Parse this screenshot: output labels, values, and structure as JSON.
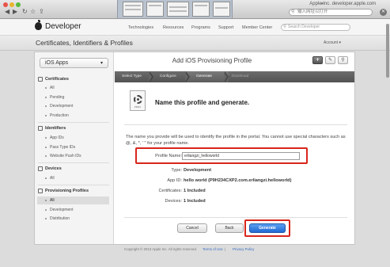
{
  "browser": {
    "url_hint": "Apple Inc. developer.apple.com",
    "search_text": "输入网址以打开"
  },
  "header": {
    "brand": "Developer",
    "nav": [
      "Technologies",
      "Resources",
      "Programs",
      "Support",
      "Member Center"
    ],
    "search_placeholder": "Search Developer"
  },
  "section": {
    "title": "Certificates, Identifiers & Profiles",
    "account": "Account ▾"
  },
  "sidebar": {
    "dropdown": "iOS Apps",
    "groups": [
      {
        "title": "Certificates",
        "items": [
          "All",
          "Pending",
          "Development",
          "Production"
        ]
      },
      {
        "title": "Identifiers",
        "items": [
          "App IDs",
          "Pass Type IDs",
          "Website Push IDs"
        ]
      },
      {
        "title": "Devices",
        "items": [
          "All"
        ]
      },
      {
        "title": "Provisioning Profiles",
        "items": [
          "All",
          "Development",
          "Distribution"
        ]
      }
    ],
    "active_item": "Provisioning Profiles / All"
  },
  "main": {
    "title": "Add iOS Provisioning Profile",
    "tools": [
      "+",
      "✎",
      "⚲"
    ],
    "steps": [
      "Select Type",
      "Configure",
      "Generate",
      "Download"
    ],
    "active_step": "Generate",
    "doc_icon_label": "PROV",
    "heading": "Name this profile and generate.",
    "description": "The name you provide will be used to identify the profile in the portal. You cannot use special characters such as @, &, *, ' \" for your profile name.",
    "fields": {
      "profile_name_label": "Profile Name:",
      "profile_name_value": "erliangzi_helloworld",
      "type_label": "Type:",
      "type_value": "Development",
      "appid_label": "App ID:",
      "appid_value": "hello world (P9H234CXP2.com.erliangzi.helloworld)",
      "certs_label": "Certificates:",
      "certs_value": "1 Included",
      "devices_label": "Devices:",
      "devices_value": "1 Included"
    },
    "buttons": {
      "cancel": "Cancel",
      "back": "Back",
      "generate": "Generate"
    }
  },
  "footer": {
    "copyright": "Copyright © 2013 Apple Inc. All rights reserved.",
    "terms": "Terms of Use",
    "privacy": "Privacy Policy"
  },
  "colors": {
    "highlight_red": "#d8261c",
    "primary_blue": "#2169d3",
    "step_bar": "#5c5c5c"
  }
}
